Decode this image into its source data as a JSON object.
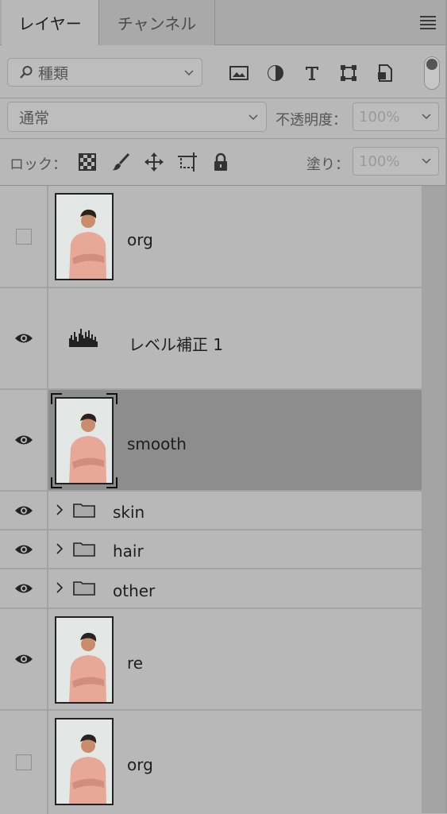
{
  "tabs": {
    "layers": "レイヤー",
    "channels": "チャンネル"
  },
  "filter": {
    "kind_label": "種類"
  },
  "blend": {
    "mode": "通常",
    "opacity_label": "不透明度：",
    "opacity_value": "100%"
  },
  "lock": {
    "label": "ロック：",
    "fill_label": "塗り：",
    "fill_value": "100%"
  },
  "layers": [
    {
      "name": "org",
      "visible": false,
      "kind": "pixel"
    },
    {
      "name": "レベル補正 1",
      "visible": true,
      "kind": "adjustment"
    },
    {
      "name": "smooth",
      "visible": true,
      "kind": "pixel",
      "selected": true
    },
    {
      "name": "skin",
      "visible": true,
      "kind": "group"
    },
    {
      "name": "hair",
      "visible": true,
      "kind": "group"
    },
    {
      "name": "other",
      "visible": true,
      "kind": "group"
    },
    {
      "name": "re",
      "visible": true,
      "kind": "pixel"
    },
    {
      "name": "org",
      "visible": false,
      "kind": "pixel"
    }
  ],
  "colors": {
    "panel_bg": "#b8b8b8",
    "selected_bg": "#8d8d8d",
    "tab_bg": "#a9a9a9"
  }
}
